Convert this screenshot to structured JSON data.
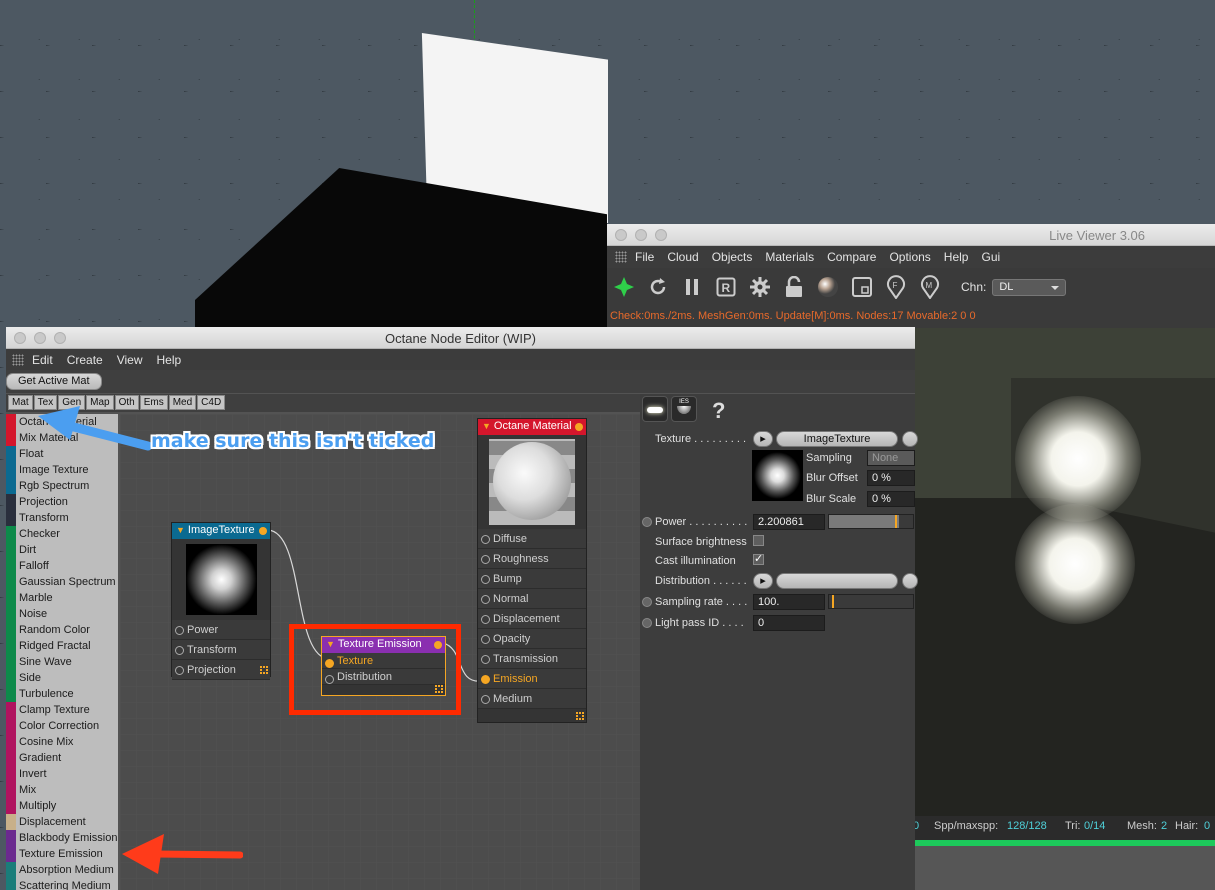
{
  "live_viewer": {
    "title": "Live Viewer 3.06",
    "menu": [
      "File",
      "Cloud",
      "Objects",
      "Materials",
      "Compare",
      "Options",
      "Help",
      "Gui"
    ],
    "channel_label": "Chn:",
    "channel_value": "DL",
    "status": "Check:0ms./2ms. MeshGen:0ms. Update[M]:0ms. Nodes:17 Movable:2  0 0",
    "stats": {
      "spp_label": "Spp/maxspp:",
      "spp_value": "128/128",
      "tri_label": "Tri:",
      "tri_value": "0/14",
      "mesh_label": "Mesh:",
      "mesh_value": "2",
      "hair_label": "Hair:",
      "hair_value": "0",
      "left_value": "0"
    }
  },
  "node_editor": {
    "title": "Octane Node Editor (WIP)",
    "menu": [
      "Edit",
      "Create",
      "View",
      "Help"
    ],
    "get_active_mat": "Get Active Mat",
    "tabs": [
      "Mat",
      "Tex",
      "Gen",
      "Map",
      "Oth",
      "Ems",
      "Med",
      "C4D"
    ],
    "node_list": [
      {
        "label": "Octane Material",
        "color": "#d4162c"
      },
      {
        "label": "Mix Material",
        "color": "#d4162c"
      },
      {
        "label": "Float",
        "color": "#0b6a91"
      },
      {
        "label": "Image Texture",
        "color": "#0b6a91"
      },
      {
        "label": "Rgb Spectrum",
        "color": "#0b6a91"
      },
      {
        "label": "Projection",
        "color": "#2a2f3d"
      },
      {
        "label": "Transform",
        "color": "#2a2f3d"
      },
      {
        "label": "Checker",
        "color": "#0d8a4a"
      },
      {
        "label": "Dirt",
        "color": "#0d8a4a"
      },
      {
        "label": "Falloff",
        "color": "#0d8a4a"
      },
      {
        "label": "Gaussian Spectrum",
        "color": "#0d8a4a"
      },
      {
        "label": "Marble",
        "color": "#0d8a4a"
      },
      {
        "label": "Noise",
        "color": "#0d8a4a"
      },
      {
        "label": "Random Color",
        "color": "#0d8a4a"
      },
      {
        "label": "Ridged Fractal",
        "color": "#0d8a4a"
      },
      {
        "label": "Sine Wave",
        "color": "#0d8a4a"
      },
      {
        "label": "Side",
        "color": "#0d8a4a"
      },
      {
        "label": "Turbulence",
        "color": "#0d8a4a"
      },
      {
        "label": "Clamp Texture",
        "color": "#b0135f"
      },
      {
        "label": "Color Correction",
        "color": "#b0135f"
      },
      {
        "label": "Cosine Mix",
        "color": "#b0135f"
      },
      {
        "label": "Gradient",
        "color": "#b0135f"
      },
      {
        "label": "Invert",
        "color": "#b0135f"
      },
      {
        "label": "Mix",
        "color": "#b0135f"
      },
      {
        "label": "Multiply",
        "color": "#b0135f"
      },
      {
        "label": "Displacement",
        "color": "#c8b089"
      },
      {
        "label": "Blackbody Emission",
        "color": "#6b2a8f"
      },
      {
        "label": "Texture Emission",
        "color": "#6b2a8f"
      },
      {
        "label": "Absorption Medium",
        "color": "#1a7d7a"
      },
      {
        "label": "Scattering Medium",
        "color": "#1a7d7a"
      }
    ],
    "nodes": {
      "image_texture": {
        "title": "ImageTexture",
        "ports": [
          "Power",
          "Transform",
          "Projection"
        ],
        "color": "#0b6a91"
      },
      "texture_emission": {
        "title": "Texture Emission",
        "ports": [
          "Texture",
          "Distribution"
        ],
        "color": "#8a2fb0"
      },
      "octane_material": {
        "title": "Octane Material",
        "ports": [
          "Diffuse",
          "Roughness",
          "Bump",
          "Normal",
          "Displacement",
          "Opacity",
          "Transmission",
          "Emission",
          "Medium"
        ],
        "color": "#d4162c"
      }
    },
    "properties": {
      "texture_label": "Texture . . . . . . . . .",
      "texture_button": "ImageTexture",
      "sampling_label": "Sampling",
      "sampling_value": "None",
      "blur_offset_label": "Blur Offset",
      "blur_offset_value": "0 %",
      "blur_scale_label": "Blur Scale",
      "blur_scale_value": "0 %",
      "power_label": "Power . . . . . . . . . .",
      "power_value": "2.200861",
      "surface_brightness_label": "Surface brightness",
      "cast_illumination_label": "Cast illumination",
      "distribution_label": "Distribution . . . . . .",
      "sampling_rate_label": "Sampling rate . . . .",
      "sampling_rate_value": "100.",
      "light_pass_label": "Light pass ID . . . .",
      "light_pass_value": "0",
      "ies_label": "IES",
      "help_label": "?"
    }
  },
  "annotation": {
    "text": "make sure this isn't ticked"
  }
}
